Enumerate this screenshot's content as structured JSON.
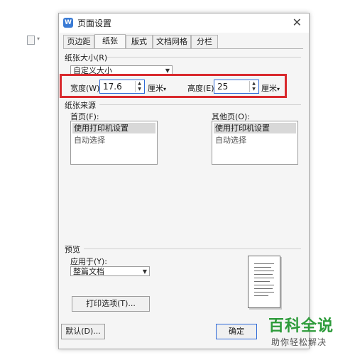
{
  "background_icons": {
    "doc_icon": "document-icon",
    "caret": "▾"
  },
  "dialog": {
    "title": "页面设置",
    "logo_letter": "W",
    "close": "✕",
    "tabs": [
      "页边距",
      "纸张",
      "版式",
      "文档网格",
      "分栏"
    ],
    "active_tab": "纸张"
  },
  "paper_size": {
    "section_label": "纸张大小(R)",
    "preset_value": "自定义大小",
    "width_label": "宽度(W):",
    "width_value": "17.6",
    "width_unit": "厘米",
    "height_label": "高度(E):",
    "height_value": "25",
    "height_unit": "厘米"
  },
  "paper_source": {
    "section_label": "纸张来源",
    "first_page_label": "首页(F):",
    "first_page_items": [
      "使用打印机设置",
      "自动选择"
    ],
    "other_pages_label": "其他页(O):",
    "other_pages_items": [
      "使用打印机设置",
      "自动选择"
    ]
  },
  "preview": {
    "section_label": "预览",
    "apply_to_label": "应用于(Y):",
    "apply_to_value": "整篇文档",
    "print_options_button": "打印选项(T)..."
  },
  "footer": {
    "default_button": "默认(D)...",
    "ok_button": "确定"
  },
  "watermark": {
    "title": "百科全说",
    "subtitle": "助你轻松解决"
  },
  "colors": {
    "highlight": "#d9292d",
    "accent": "#2f6ad8",
    "watermark_green": "#2d9b3a"
  }
}
